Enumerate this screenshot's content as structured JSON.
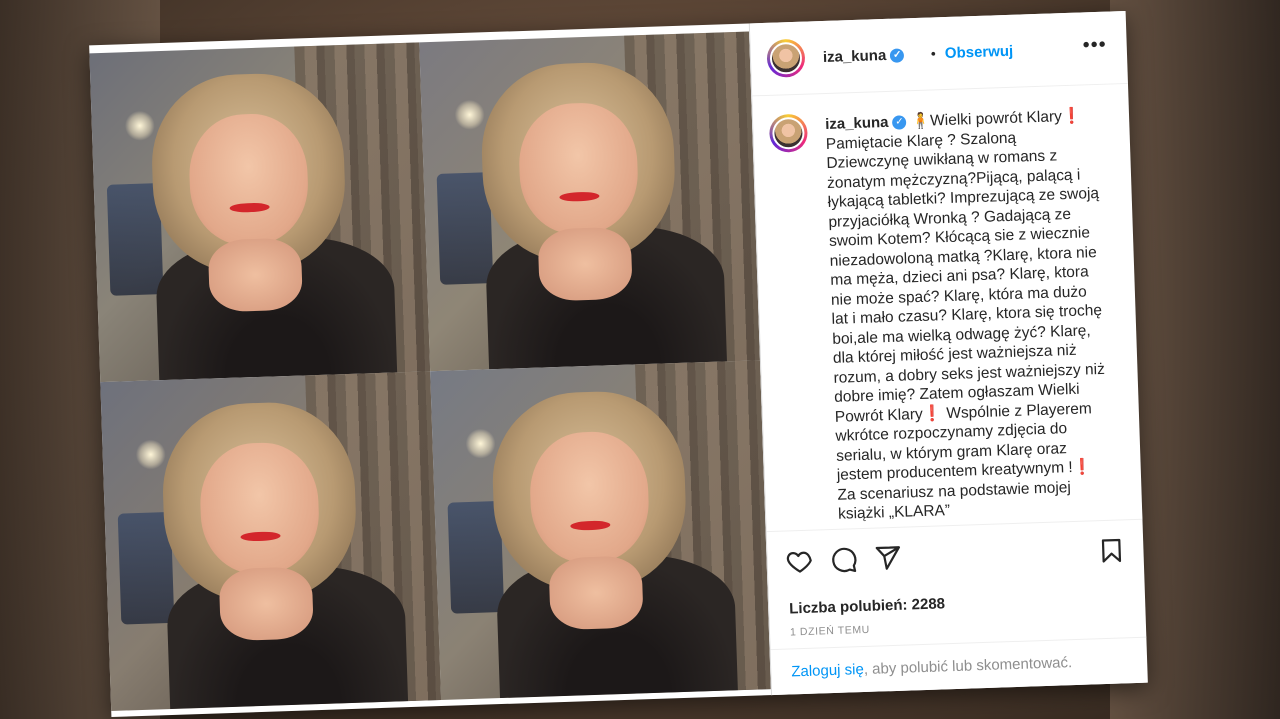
{
  "post": {
    "username": "iza_kuna",
    "verified_icon": "verified-badge-icon",
    "separator": "•",
    "follow_label": "Obserwuj",
    "more_label": "•••",
    "caption_emoji": "🧍",
    "caption_text": "Wielki powrót Klary❗ Pamiętacie Klarę ? Szaloną Dziewczynę uwikłaną w romans z żonatym mężczyzną?Pijącą, palącą i łykającą tabletki? Imprezującą ze swoją przyjaciółką Wronką ? Gadającą ze swoim Kotem? Kłócącą sie z wiecznie niezadowoloną matką ?Klarę, ktora nie ma męża, dzieci ani psa? Klarę, ktora nie może spać? Klarę, która ma dużo lat i mało czasu? Klarę, ktora się trochę boi,ale ma wielką odwagę żyć? Klarę, dla której miłość jest ważniejsza niż rozum, a dobry seks jest ważniejszy niż dobre imię? Zatem ogłaszam Wielki Powrót Klary❗ Wspólnie z Playerem wkrótce rozpoczynamy zdjęcia do serialu, w którym gram Klarę oraz jestem producentem kreatywnym !❗ Za scenariusz na podstawie mojej książki „KLARA”",
    "likes_label": "Liczba polubień: 2288",
    "time_label": "1 DZIEŃ TEMU",
    "login_link": "Zaloguj się",
    "login_rest": ", aby polubić lub skomentować."
  },
  "icons": {
    "like": "heart-icon",
    "comment": "comment-icon",
    "share": "paper-plane-icon",
    "save": "bookmark-icon"
  },
  "colors": {
    "link": "#0095f6",
    "verified": "#3897f0",
    "text": "#262626",
    "muted": "#8e8e8e"
  }
}
